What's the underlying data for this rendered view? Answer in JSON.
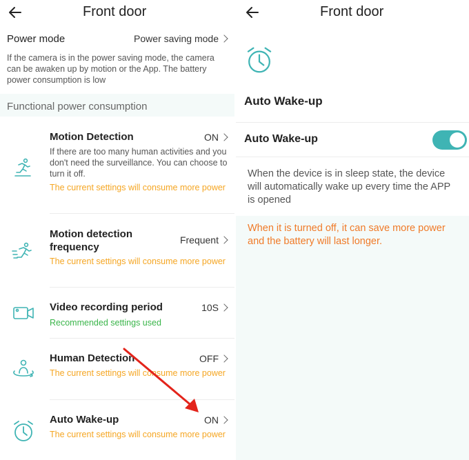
{
  "left": {
    "title": "Front door",
    "power_mode": {
      "label": "Power mode",
      "value": "Power saving mode",
      "description": "If the camera is in the power saving mode, the camera can be awaken up by motion or the App. The battery power consumption is low"
    },
    "section_label": "Functional power consumption",
    "items": [
      {
        "icon": "running-person-icon",
        "title": "Motion Detection",
        "value": "ON",
        "description": "If there are too many human activities and you don't need the surveillance. You can choose to turn it off.",
        "note": "The current settings will consume more power"
      },
      {
        "icon": "running-person-frequency-icon",
        "title_line1": "Motion detection",
        "title_line2": "frequency",
        "value": "Frequent",
        "note": "The current settings will consume more power"
      },
      {
        "icon": "video-camera-icon",
        "title": "Video recording period",
        "value": "10S",
        "note": "Recommended settings used"
      },
      {
        "icon": "human-detection-icon",
        "title": "Human Detection",
        "value": "OFF",
        "note": "The current settings will consume more power"
      },
      {
        "icon": "alarm-clock-icon",
        "title": "Auto Wake-up",
        "value": "ON",
        "note": "The current settings will consume more power"
      }
    ]
  },
  "right": {
    "title": "Front door",
    "header_icon": "alarm-clock-icon",
    "heading": "Auto Wake-up",
    "toggle_label": "Auto Wake-up",
    "toggle_on": true,
    "description": "When the device is in sleep state, the device will automatically wake up every time the APP is opened",
    "note": "When it is turned off, it can save more power and the battery will last longer."
  },
  "colors": {
    "accent": "#3fb4b4",
    "warning": "#f5a623",
    "success": "#3ab54a",
    "note_orange": "#f07a28",
    "annotation_arrow": "#e3241b"
  }
}
